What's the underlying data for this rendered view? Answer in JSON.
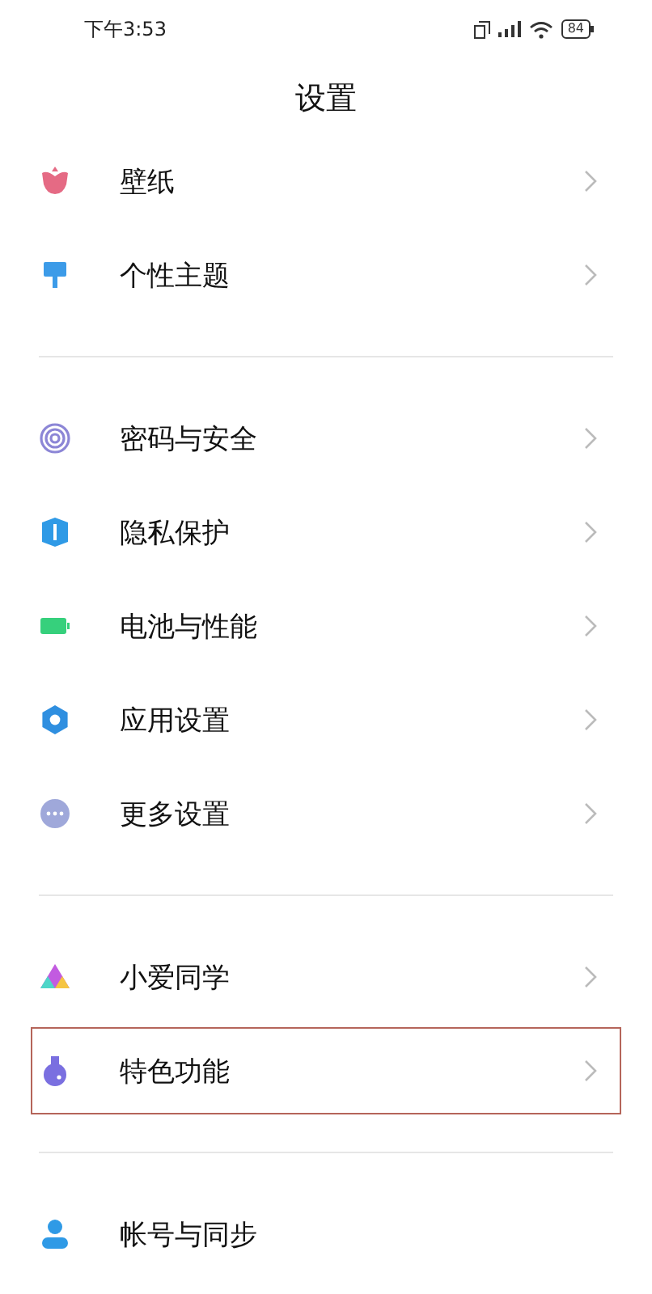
{
  "status_bar": {
    "time": "下午3:53",
    "battery": "84"
  },
  "title": "设置",
  "sections": [
    {
      "items": [
        {
          "label": "壁纸",
          "chevron": true,
          "highlighted": false
        },
        {
          "label": "个性主题",
          "chevron": true,
          "highlighted": false
        }
      ]
    },
    {
      "items": [
        {
          "label": "密码与安全",
          "chevron": true,
          "highlighted": false
        },
        {
          "label": "隐私保护",
          "chevron": true,
          "highlighted": false
        },
        {
          "label": "电池与性能",
          "chevron": true,
          "highlighted": false
        },
        {
          "label": "应用设置",
          "chevron": true,
          "highlighted": false
        },
        {
          "label": "更多设置",
          "chevron": true,
          "highlighted": false
        }
      ]
    },
    {
      "items": [
        {
          "label": "小爱同学",
          "chevron": true,
          "highlighted": false
        },
        {
          "label": "特色功能",
          "chevron": true,
          "highlighted": true
        }
      ]
    },
    {
      "items": [
        {
          "label": "帐号与同步",
          "chevron": false,
          "highlighted": false
        }
      ]
    }
  ]
}
